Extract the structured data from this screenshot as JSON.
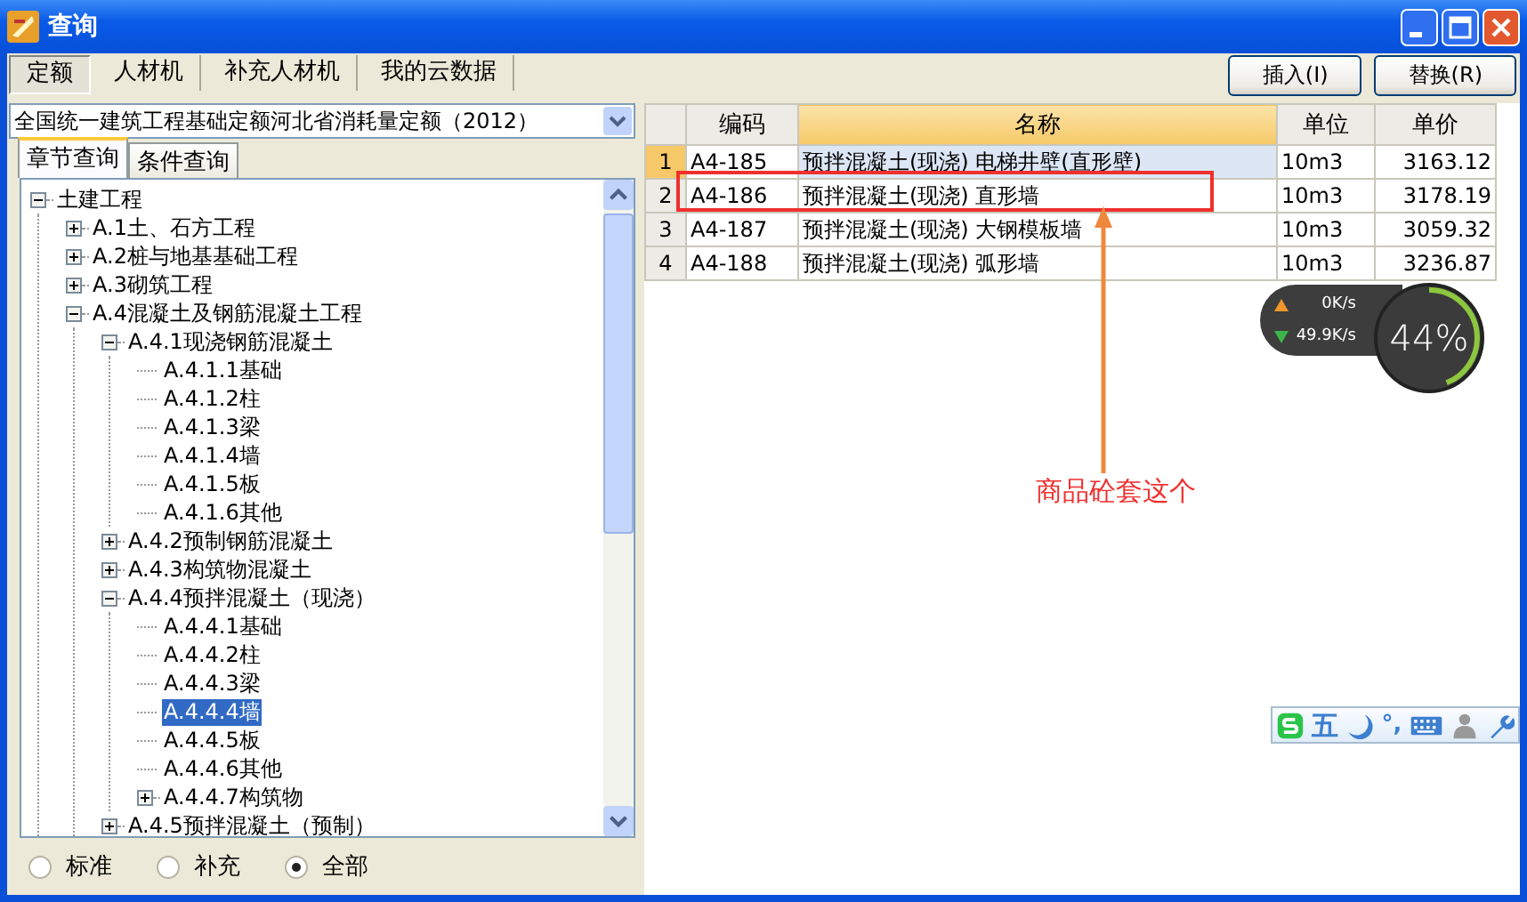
{
  "window": {
    "title": "查询"
  },
  "tabs": [
    {
      "label": "定额",
      "selected": true
    },
    {
      "label": "人材机",
      "selected": false
    },
    {
      "label": "补充人材机",
      "selected": false
    },
    {
      "label": "我的云数据",
      "selected": false
    }
  ],
  "actions": [
    "插入(I)",
    "替换(R)"
  ],
  "library": {
    "value": "全国统一建筑工程基础定额河北省消耗量定额（2012）"
  },
  "sub_tabs": [
    {
      "label": "章节查询",
      "selected": true
    },
    {
      "label": "条件查询",
      "selected": false
    }
  ],
  "tree": [
    {
      "label": "土建工程",
      "expanded": true,
      "selected": false,
      "children": [
        {
          "label": "A.1土、石方工程",
          "expanded": false,
          "selected": false
        },
        {
          "label": "A.2桩与地基基础工程",
          "expanded": false,
          "selected": false
        },
        {
          "label": "A.3砌筑工程",
          "expanded": false,
          "selected": false
        },
        {
          "label": "A.4混凝土及钢筋混凝土工程",
          "expanded": true,
          "selected": false,
          "children": [
            {
              "label": "A.4.1现浇钢筋混凝土",
              "expanded": true,
              "selected": false,
              "children": [
                {
                  "label": "A.4.1.1基础",
                  "selected": false
                },
                {
                  "label": "A.4.1.2柱",
                  "selected": false
                },
                {
                  "label": "A.4.1.3梁",
                  "selected": false
                },
                {
                  "label": "A.4.1.4墙",
                  "selected": false
                },
                {
                  "label": "A.4.1.5板",
                  "selected": false
                },
                {
                  "label": "A.4.1.6其他",
                  "selected": false
                }
              ]
            },
            {
              "label": "A.4.2预制钢筋混凝土",
              "expanded": false,
              "selected": false
            },
            {
              "label": "A.4.3构筑物混凝土",
              "expanded": false,
              "selected": false
            },
            {
              "label": "A.4.4预拌混凝土（现浇）",
              "expanded": true,
              "selected": false,
              "children": [
                {
                  "label": "A.4.4.1基础",
                  "selected": false
                },
                {
                  "label": "A.4.4.2柱",
                  "selected": false
                },
                {
                  "label": "A.4.4.3梁",
                  "selected": false
                },
                {
                  "label": "A.4.4.4墙",
                  "selected": true
                },
                {
                  "label": "A.4.4.5板",
                  "selected": false
                },
                {
                  "label": "A.4.4.6其他",
                  "selected": false
                },
                {
                  "label": "A.4.4.7构筑物",
                  "expanded": false,
                  "selected": false
                }
              ]
            },
            {
              "label": "A.4.5预拌混凝土（预制）",
              "expanded": false,
              "selected": false
            }
          ]
        }
      ]
    }
  ],
  "filters": [
    {
      "label": "标准",
      "selected": false
    },
    {
      "label": "补充",
      "selected": false
    },
    {
      "label": "全部",
      "selected": true
    }
  ],
  "table": {
    "columns": [
      {
        "label": "编码",
        "selected": false
      },
      {
        "label": "名称",
        "selected": true
      },
      {
        "label": "单位",
        "selected": false
      },
      {
        "label": "单价",
        "selected": false
      }
    ],
    "rows": [
      {
        "index": "1",
        "code": "A4-185",
        "name": "预拌混凝土(现浇) 电梯井壁(直形壁)",
        "unit": "10m3",
        "price": "3163.12",
        "selected": true
      },
      {
        "index": "2",
        "code": "A4-186",
        "name": "预拌混凝土(现浇) 直形墙",
        "unit": "10m3",
        "price": "3178.19",
        "selected": false
      },
      {
        "index": "3",
        "code": "A4-187",
        "name": "预拌混凝土(现浇) 大钢模板墙",
        "unit": "10m3",
        "price": "3059.32",
        "selected": false
      },
      {
        "index": "4",
        "code": "A4-188",
        "name": "预拌混凝土(现浇) 弧形墙",
        "unit": "10m3",
        "price": "3236.87",
        "selected": false
      }
    ]
  },
  "annotation": {
    "note": "商品砼套这个"
  },
  "monitor": {
    "upload": "0K/s",
    "download": "49.9K/s",
    "usage": "44%",
    "level": 0.44
  },
  "ime": {
    "mode": "五",
    "punctuation": "°,"
  }
}
